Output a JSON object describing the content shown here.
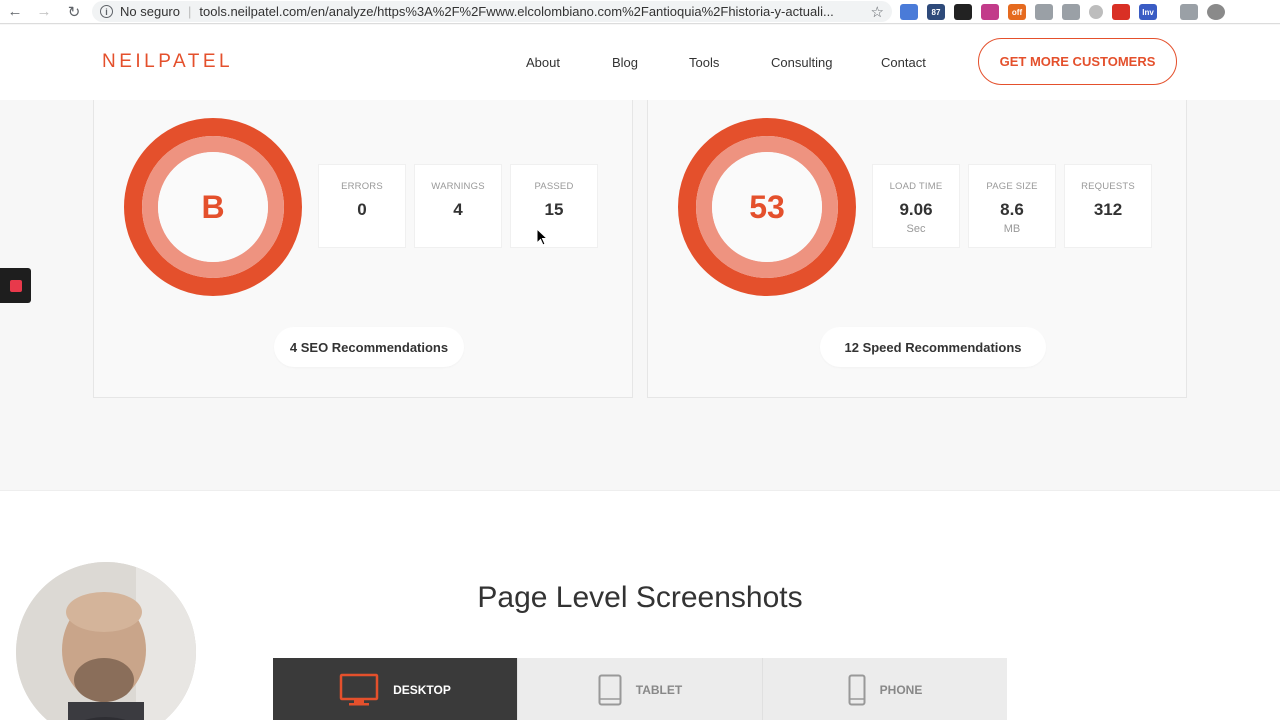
{
  "browser": {
    "security_label": "No seguro",
    "url": "tools.neilpatel.com/en/analyze/https%3A%2F%2Fwww.elcolombiano.com%2Fantioquia%2Fhistoria-y-actuali...",
    "extensions": [
      {
        "label": "",
        "color": "#4a7bd8"
      },
      {
        "label": "87",
        "color": "#2e4a7a"
      },
      {
        "label": "",
        "color": "#222222"
      },
      {
        "label": "",
        "color": "#c23b8a"
      },
      {
        "label": "off",
        "color": "#e56a1f"
      },
      {
        "label": "",
        "color": "#9aa0a6"
      },
      {
        "label": "",
        "color": "#9aa0a6"
      },
      {
        "label": "",
        "color": "#bdbdbd"
      },
      {
        "label": "",
        "color": "#d93025"
      },
      {
        "label": "Inv",
        "color": "#3a5cc4"
      },
      {
        "label": "",
        "color": "#9aa0a6"
      },
      {
        "label": "",
        "color": "#8a8a8a"
      }
    ]
  },
  "header": {
    "logo": "NEILPATEL",
    "nav": {
      "about": "About",
      "blog": "Blog",
      "tools": "Tools",
      "consulting": "Consulting",
      "contact": "Contact"
    },
    "cta": "GET MORE CUSTOMERS"
  },
  "seo": {
    "grade": "B",
    "metrics": [
      {
        "label": "ERRORS",
        "value": "0"
      },
      {
        "label": "WARNINGS",
        "value": "4"
      },
      {
        "label": "PASSED",
        "value": "15"
      }
    ],
    "recommendations": "4 SEO Recommendations"
  },
  "speed": {
    "score": "53",
    "metrics": [
      {
        "label": "LOAD TIME",
        "value": "9.06",
        "unit": "Sec"
      },
      {
        "label": "PAGE SIZE",
        "value": "8.6",
        "unit": "MB"
      },
      {
        "label": "REQUESTS",
        "value": "312",
        "unit": ""
      }
    ],
    "recommendations": "12 Speed Recommendations"
  },
  "screenshots": {
    "title": "Page Level Screenshots",
    "tabs": {
      "desktop": "DESKTOP",
      "tablet": "TABLET",
      "phone": "PHONE"
    }
  },
  "colors": {
    "accent": "#e4502c",
    "ring_inner": "#ee9380",
    "active_tab": "#3a3a3a"
  }
}
